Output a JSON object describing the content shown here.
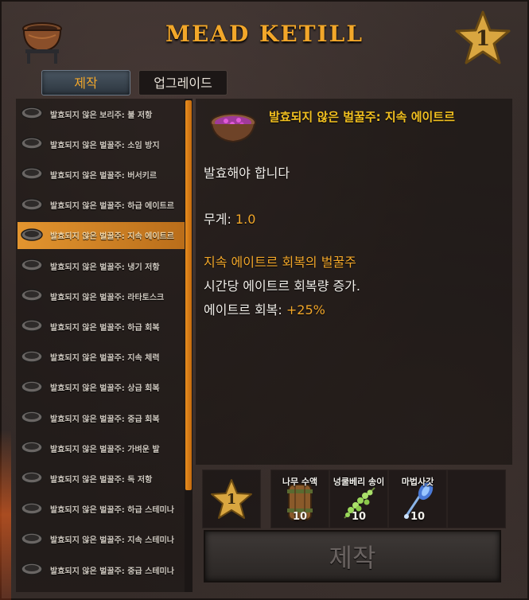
{
  "header": {
    "title": "MEAD KETILL",
    "station_icon": "cauldron-icon",
    "level": "1"
  },
  "tabs": [
    {
      "label": "제작",
      "active": true
    },
    {
      "label": "업그레이드",
      "active": false
    }
  ],
  "recipes": [
    {
      "label": "발효되지 않은 보리주: 불 저항",
      "selected": false
    },
    {
      "label": "발효되지 않은 벌꿀주: 소임 방지",
      "selected": false
    },
    {
      "label": "발효되지 않은 벌꿀주: 버서키르",
      "selected": false
    },
    {
      "label": "발효되지 않은 벌꿀주: 하급 에이트르",
      "selected": false
    },
    {
      "label": "발효되지 않은 벌꿀주: 지속 에이트르",
      "selected": true
    },
    {
      "label": "발효되지 않은 벌꿀주: 냉기 저항",
      "selected": false
    },
    {
      "label": "발효되지 않은 벌꿀주: 라타토스크",
      "selected": false
    },
    {
      "label": "발효되지 않은 벌꿀주: 하급 회복",
      "selected": false
    },
    {
      "label": "발효되지 않은 벌꿀주: 지속 체력",
      "selected": false
    },
    {
      "label": "발효되지 않은 벌꿀주: 상급 회복",
      "selected": false
    },
    {
      "label": "발효되지 않은 벌꿀주: 중급 회복",
      "selected": false
    },
    {
      "label": "발효되지 않은 벌꿀주: 가벼운 발",
      "selected": false
    },
    {
      "label": "발효되지 않은 벌꿀주: 독 저항",
      "selected": false
    },
    {
      "label": "발효되지 않은 벌꿀주: 하급 스테미나",
      "selected": false
    },
    {
      "label": "발효되지 않은 벌꿀주: 지속 스테미나",
      "selected": false
    },
    {
      "label": "발효되지 않은 벌꿀주: 중급 스테미나",
      "selected": false
    }
  ],
  "detail": {
    "title": "발효되지 않은 벌꿀주: 지속 에이트르",
    "description": "발효해야 합니다",
    "weight_label": "무게: ",
    "weight_value": "1.0",
    "effect_name": "지속 에이트르 회복의 벌꿀주",
    "effect_desc": "시간당 에이트르 회복량 증가.",
    "eitr_label": "에이트르 회복: ",
    "eitr_value": "+25%"
  },
  "requirements": {
    "station_level": "1",
    "items": [
      {
        "name": "나무 수액",
        "qty": "10",
        "icon": "sap-barrel-icon"
      },
      {
        "name": "넝쿨베리 송이",
        "qty": "10",
        "icon": "vineberry-icon"
      },
      {
        "name": "마법사갓",
        "qty": "10",
        "icon": "magecap-icon"
      }
    ]
  },
  "craft_button": {
    "label": "제작"
  },
  "colors": {
    "accent": "#f2a72a",
    "title_gold": "#f2c020",
    "selected_row": "#e3952f"
  }
}
